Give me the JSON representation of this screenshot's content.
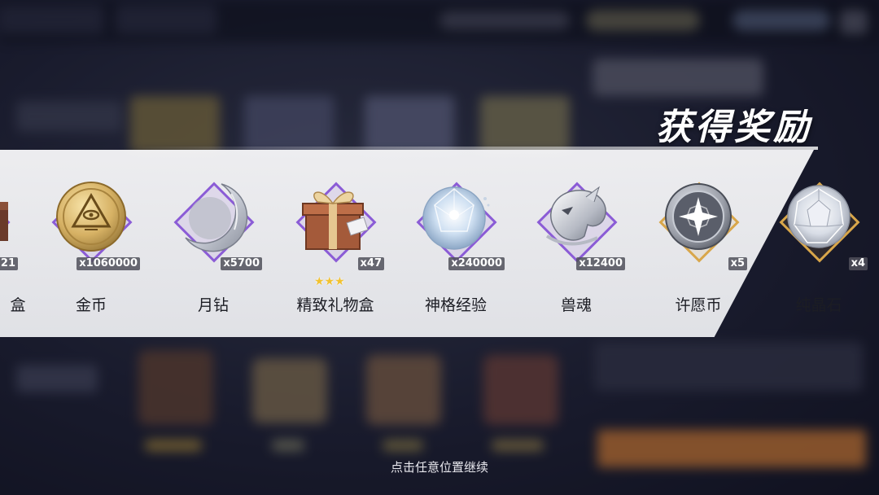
{
  "reward_title": "获得奖励",
  "continue_hint": "点击任意位置继续",
  "items": [
    {
      "name": "盒",
      "quantity": "21",
      "icon": "box-icon",
      "frame": "purple"
    },
    {
      "name": "金币",
      "quantity": "x1060000",
      "icon": "gold-coin-icon",
      "frame": "purple"
    },
    {
      "name": "月钻",
      "quantity": "x5700",
      "icon": "moon-diamond-icon",
      "frame": "purple"
    },
    {
      "name": "精致礼物盒",
      "quantity": "x47",
      "icon": "gift-box-icon",
      "frame": "purple",
      "stars": "★★★"
    },
    {
      "name": "神格经验",
      "quantity": "x240000",
      "icon": "crystal-orb-icon",
      "frame": "purple"
    },
    {
      "name": "兽魂",
      "quantity": "x12400",
      "icon": "beast-soul-icon",
      "frame": "purple"
    },
    {
      "name": "许愿币",
      "quantity": "x5",
      "icon": "wish-coin-icon",
      "frame": "gold"
    },
    {
      "name": "纯晶石",
      "quantity": "x4",
      "icon": "pure-crystal-icon",
      "frame": "gold"
    }
  ],
  "colors": {
    "purple_frame": "#8b5cd6",
    "gold_frame": "#d8a64a",
    "strip": "#eeeef1"
  }
}
